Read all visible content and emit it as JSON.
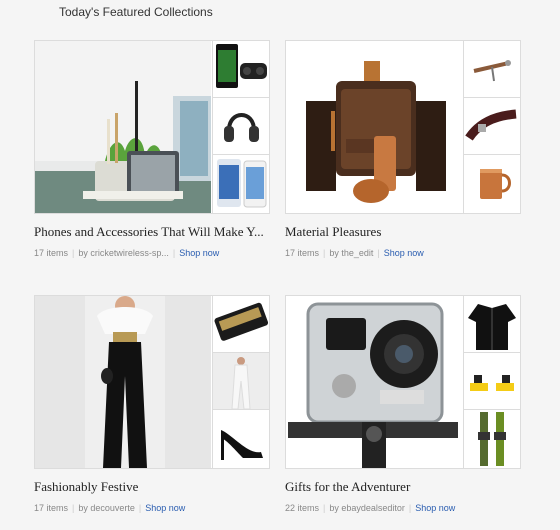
{
  "section": {
    "title": "Today's Featured Collections"
  },
  "collections": [
    {
      "title": "Phones and Accessories That Will Make Y...",
      "items": "17 items",
      "by": "by cricketwireless-sp...",
      "shop": "Shop now",
      "main_image": "desk-phone-stand-plant-image",
      "thumbs": [
        "smartphone-vr-headset-image",
        "headphones-image",
        "samsung-phones-image"
      ]
    },
    {
      "title": "Material Pleasures",
      "items": "17 items",
      "by": "by the_edit",
      "shop": "Shop now",
      "main_image": "leather-flask-copper-image",
      "thumbs": [
        "corkscrew-image",
        "leather-strap-image",
        "copper-mug-image"
      ]
    },
    {
      "title": "Fashionably Festive",
      "items": "17 items",
      "by": "by decouverte",
      "shop": "Shop now",
      "main_image": "woman-black-jumpsuit-image",
      "thumbs": [
        "gold-clutch-image",
        "white-jumpsuit-image",
        "black-heels-image"
      ]
    },
    {
      "title": "Gifts for the Adventurer",
      "items": "22 items",
      "by": "by ebaydealseditor",
      "shop": "Shop now",
      "main_image": "gopro-hero4-camera-image",
      "thumbs": [
        "black-jacket-image",
        "ski-bindings-image",
        "skis-image"
      ]
    }
  ]
}
